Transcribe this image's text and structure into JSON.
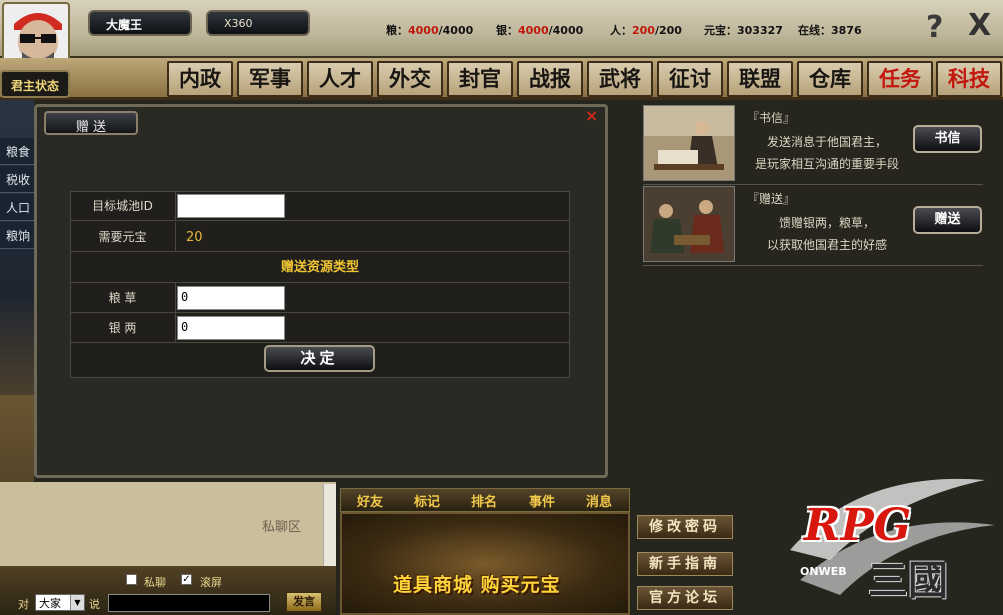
{
  "header": {
    "player_name": "大魔王",
    "coord": "X360",
    "resources": {
      "grain_label": "粮：",
      "grain_cur": "4000",
      "grain_max": "/4000",
      "silver_label": "银：",
      "silver_cur": "4000",
      "silver_max": "/4000",
      "pop_label": "人：",
      "pop_cur": "200",
      "pop_max": "/200",
      "yuanbao": "元宝：303327",
      "online": "在线：3876"
    },
    "help": "?",
    "close": "X"
  },
  "king_status": "君主状态",
  "nav": [
    "内政",
    "军事",
    "人才",
    "外交",
    "封官",
    "战报",
    "武将",
    "征讨",
    "联盟",
    "仓库",
    "任务",
    "科技"
  ],
  "left_labels": [
    "粮食",
    "税收",
    "人口",
    "粮饷"
  ],
  "dialog": {
    "tab": "赠 送",
    "close": "×",
    "target_label": "目标城池ID",
    "target_value": "",
    "cost_label": "需要元宝",
    "cost_value": "20",
    "type_heading": "赠送资源类型",
    "grain_label": "粮 草",
    "grain_value": "0",
    "silver_label": "银 两",
    "silver_value": "0",
    "confirm": "决定"
  },
  "chat": {
    "private_zone": "私聊区",
    "private_check": "私聊",
    "scroll_check": "滚屏",
    "to_label": "对",
    "channel": "大家",
    "say_label": "说",
    "send": "发言"
  },
  "bottom_tabs": [
    "好友",
    "标记",
    "排名",
    "事件",
    "消息"
  ],
  "banner": "道具商城 购买元宝",
  "right": {
    "letter_title": "『书信』",
    "letter_desc1": "发送消息于他国君主，",
    "letter_desc2": "是玩家相互沟通的重要手段",
    "letter_btn": "书信",
    "gift_title": "『赠送』",
    "gift_desc1": "馈赠银两，粮草，",
    "gift_desc2": "以获取他国君主的好感",
    "gift_btn": "赠送",
    "menu": [
      "修改密码",
      "新手指南",
      "官方论坛"
    ]
  },
  "logo": {
    "rpg": "RPG",
    "sanguo": "三國",
    "onweb": "ONWEB"
  },
  "colors": {
    "accent_red": "#c0190c",
    "gold": "#f1c531"
  }
}
